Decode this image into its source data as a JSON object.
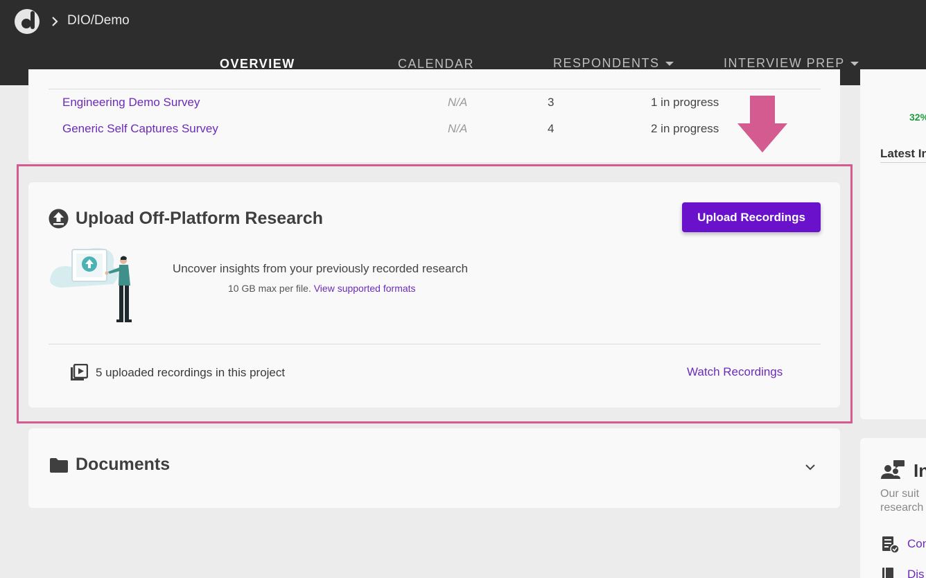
{
  "header": {
    "breadcrumb": "DIO/Demo",
    "tabs": [
      {
        "label": "OVERVIEW"
      },
      {
        "label": "CALENDAR"
      },
      {
        "label": "RESPONDENTS"
      },
      {
        "label": "INTERVIEW PREP"
      }
    ]
  },
  "surveys": [
    {
      "name": "Engineering Demo Survey",
      "date": "N/A",
      "count": "3",
      "status": "1 in progress"
    },
    {
      "name": "Generic Self Captures Survey",
      "date": "N/A",
      "count": "4",
      "status": "2 in progress"
    }
  ],
  "upload": {
    "title": "Upload Off-Platform Research",
    "button": "Upload Recordings",
    "description": "Uncover insights from your previously recorded research",
    "limit": "10 GB max per file.",
    "formats_link": "View supported formats",
    "recordings_count": "5 uploaded recordings in this project",
    "watch_link": "Watch Recordings"
  },
  "documents": {
    "title": "Documents"
  },
  "sidebar": {
    "percent": "32%",
    "latest_heading": "Latest In",
    "card2_title": "In",
    "card2_text_line1": "Our suit",
    "card2_text_line2": "research",
    "link1": "Con",
    "link2": "Dis"
  },
  "colors": {
    "accent": "#6a11cb",
    "highlight": "#d45b90",
    "header_bg": "#2d2d2d"
  }
}
